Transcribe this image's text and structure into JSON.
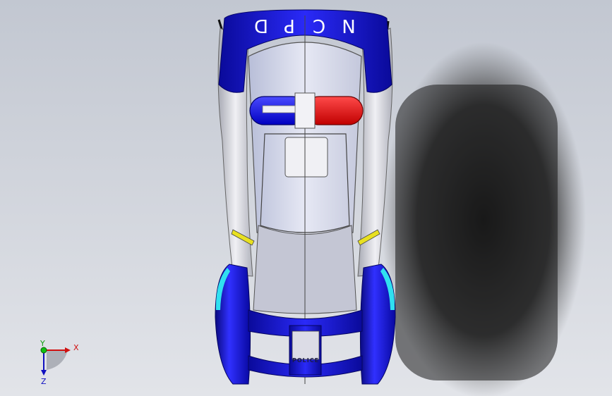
{
  "model": {
    "roof_letters": [
      "N",
      "C",
      "P",
      "D"
    ],
    "rear_label": "POLICE",
    "colors": {
      "body_blue": "#1a1aee",
      "body_blue_dark": "#0a0a8a",
      "light_red": "#e01818",
      "light_blue": "#1a1ae0",
      "panel_silver": "#dcdce6",
      "accent_yellow": "#e8e020",
      "accent_cyan": "#30e0f0"
    }
  },
  "triad": {
    "x_label": "X",
    "y_label": "Y",
    "z_label": "Z"
  }
}
